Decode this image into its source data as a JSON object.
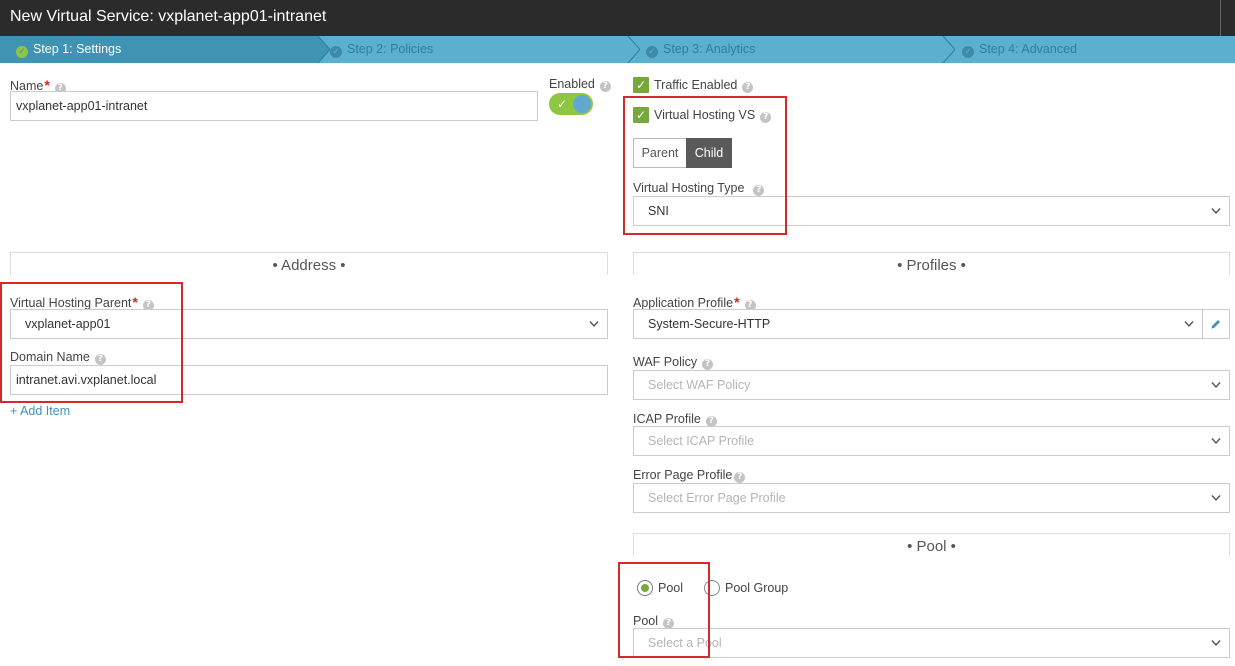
{
  "window": {
    "title": "New Virtual Service: vxplanet-app01-intranet"
  },
  "wizard": {
    "steps": [
      {
        "label": "Step 1: Settings"
      },
      {
        "label": "Step 2: Policies"
      },
      {
        "label": "Step 3: Analytics"
      },
      {
        "label": "Step 4: Advanced"
      }
    ],
    "active_step": 1
  },
  "settings": {
    "name_label": "Name",
    "name_value": "vxplanet-app01-intranet",
    "enabled_label": "Enabled",
    "enabled": true,
    "traffic_enabled_label": "Traffic Enabled",
    "traffic_enabled": true,
    "virtual_hosting_vs_label": "Virtual Hosting VS",
    "virtual_hosting_vs": true,
    "parent_label": "Parent",
    "child_label": "Child",
    "selected_role": "Child",
    "virtual_hosting_type_label": "Virtual Hosting Type",
    "virtual_hosting_type_value": "SNI"
  },
  "address": {
    "section_title": "• Address •",
    "vh_parent_label": "Virtual Hosting Parent",
    "vh_parent_value": "vxplanet-app01",
    "domain_name_label": "Domain Name",
    "domain_name_value": "intranet.avi.vxplanet.local",
    "add_item_label": "+ Add Item"
  },
  "profiles": {
    "section_title": "• Profiles •",
    "app_profile_label": "Application Profile",
    "app_profile_value": "System-Secure-HTTP",
    "waf_label": "WAF Policy",
    "waf_placeholder": "Select WAF Policy",
    "icap_label": "ICAP Profile",
    "icap_placeholder": "Select ICAP Profile",
    "error_page_label": "Error Page Profile",
    "error_page_placeholder": "Select Error Page Profile"
  },
  "pool": {
    "section_title": "• Pool •",
    "option_pool": "Pool",
    "option_pool_group": "Pool Group",
    "selected": "Pool",
    "pool_label": "Pool",
    "pool_placeholder": "Select a Pool"
  },
  "colors": {
    "titlebar": "#2b2b2b",
    "wizard_bar": "#5bb0cf",
    "wizard_active": "#3f93b5",
    "check_green": "#77a83b",
    "highlight_red": "#d42a2a"
  },
  "icons": {
    "help": "question-circle-icon",
    "caret": "chevron-down-icon",
    "edit": "pencil-icon",
    "check": "check-icon"
  }
}
